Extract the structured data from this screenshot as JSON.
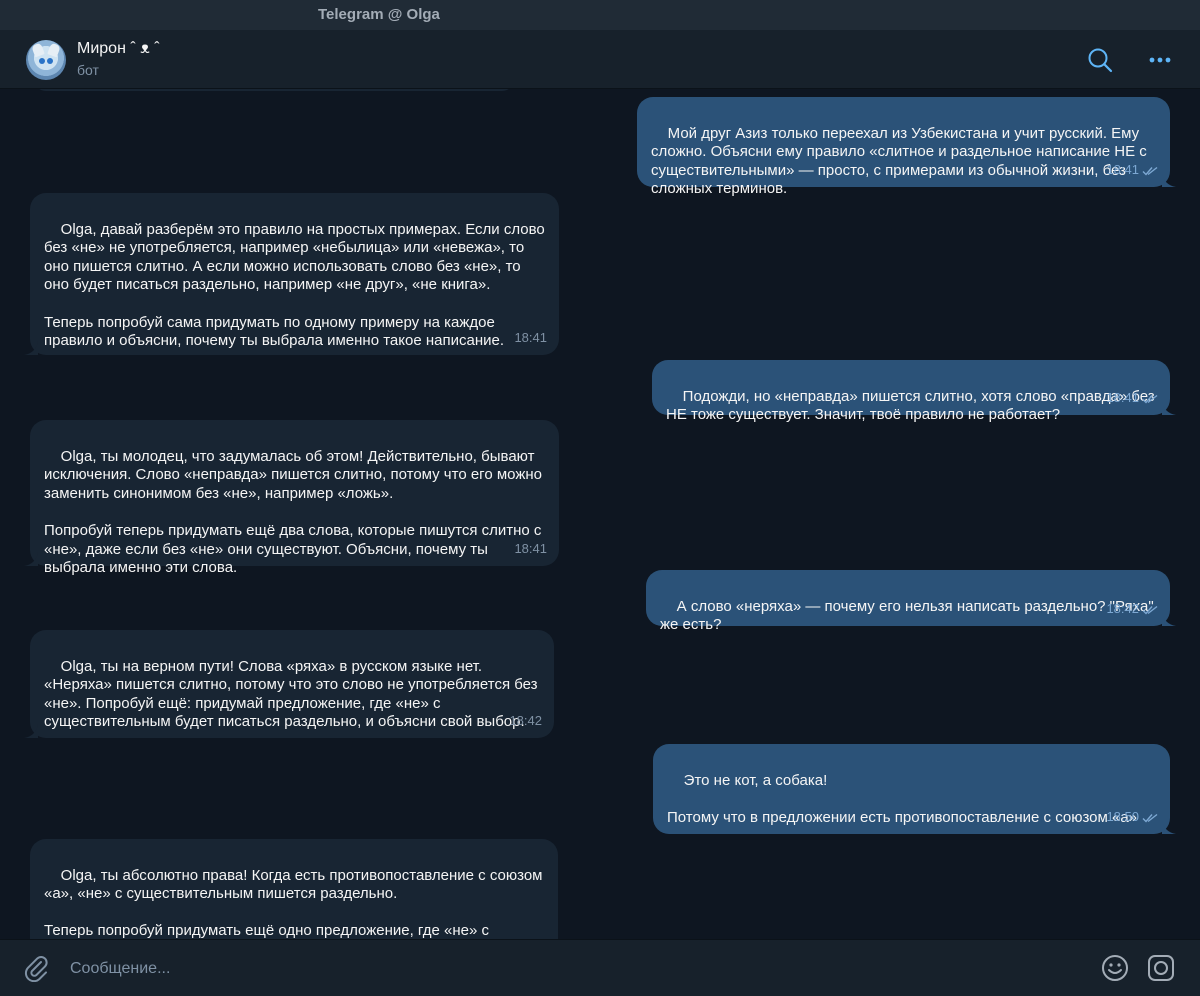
{
  "window": {
    "title": "Telegram @ Olga"
  },
  "header": {
    "name": "Мирон ˆ ᴥ ˆ",
    "status": "бот"
  },
  "messages": [
    {
      "dir": "out",
      "text": "Мой друг Азиз только переехал из Узбекистана и учит русский. Ему сложно. Объясни ему правило «слитное и раздельное написание НЕ с существительными» — просто, с примерами из обычной жизни, без сложных терминов.",
      "time": "18:41",
      "read": true
    },
    {
      "dir": "in",
      "text": "Olga, давай разберём это правило на простых примерах. Если слово без «не» не употребляется, например «небылица» или «невежа», то оно пишется слитно. А если можно использовать слово без «не», то оно будет писаться раздельно, например «не друг», «не книга».\n\nТеперь попробуй сама придумать по одному примеру на каждое правило и объясни, почему ты выбрала именно такое написание.",
      "time": "18:41"
    },
    {
      "dir": "out",
      "text": "Подожди, но «неправда» пишется слитно, хотя слово «правда» без НЕ тоже существует. Значит, твоё правило не работает?",
      "time": "18:41",
      "read": true
    },
    {
      "dir": "in",
      "text": "Olga, ты молодец, что задумалась об этом! Действительно, бывают исключения. Слово «неправда» пишется слитно, потому что его можно заменить синонимом без «не», например «ложь».\n\nПопробуй теперь придумать ещё два слова, которые пишутся слитно с «не», даже если без «не» они существуют. Объясни, почему ты выбрала именно эти слова.",
      "time": "18:41"
    },
    {
      "dir": "out",
      "text": "А слово «неряха» — почему его нельзя написать раздельно? \"Ряха\" же есть?",
      "time": "18:42",
      "read": true
    },
    {
      "dir": "in",
      "text": "Olga, ты на верном пути! Слова «ряха» в русском языке нет. «Неряха» пишется слитно, потому что это слово не употребляется без «не». Попробуй ещё: придумай предложение, где «не» с существительным будет писаться раздельно, и объясни свой выбор.",
      "time": "18:42"
    },
    {
      "dir": "out",
      "text": "Это не кот, а собака!\n\nПотому что в предложении есть противопоставление с союзом «а»",
      "time": "18:50",
      "read": true
    },
    {
      "dir": "in",
      "text": "Olga, ты абсолютно права! Когда есть противопоставление с союзом «а», «не» с существительным пишется раздельно.\n\nТеперь попробуй придумать ещё одно предложение, где «не» с существительным будет писаться раздельно, но уже без",
      "time": ""
    }
  ],
  "composer": {
    "placeholder": "Сообщение..."
  },
  "colors": {
    "background": "#0e1621",
    "incoming": "#182533",
    "outgoing": "#2b5278",
    "accent": "#5eb5f7",
    "muted": "#7f91a4"
  },
  "icons": [
    "search-icon",
    "more-icon",
    "chevron-down-icon",
    "attach-icon",
    "emoji-icon",
    "camera-icon",
    "double-check-icon"
  ]
}
